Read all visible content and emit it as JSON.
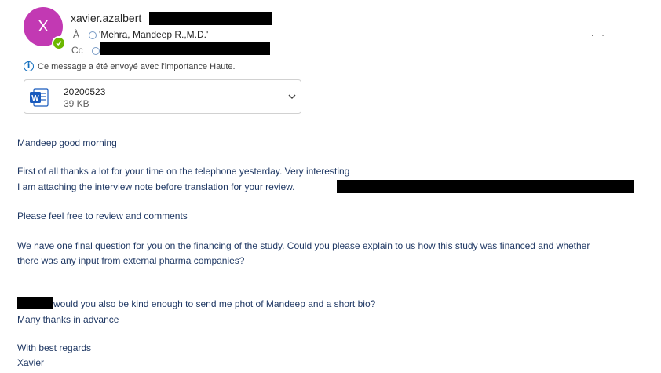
{
  "header": {
    "avatar_initial": "X",
    "sender_name": "xavier.azalbert",
    "to_label": "À",
    "to_value": "'Mehra, Mandeep R.,M.D.'",
    "cc_label": "Cc"
  },
  "importance_notice": "Ce message a été envoyé avec l'importance Haute.",
  "attachment": {
    "name": "20200523",
    "size": "39 KB",
    "icon": "word-document-icon"
  },
  "body": {
    "greeting": "Mandeep good morning",
    "p1_line1": "First of all thanks a lot for your time on the telephone yesterday. Very interesting",
    "p1_line2": "I am attaching the interview note before translation for your review.",
    "p2": "Please feel free to review and comments",
    "p3_line1": "We have one final question for you on the financing of the study.  Could you please explain to us how this study was financed and whether",
    "p3_line2": "there was any input from external pharma companies?",
    "p4_line1": "would you also be kind enough to send me  phot of Mandeep and a short bio?",
    "p4_line2": "Many thanks in advance",
    "closing": "With best regards",
    "signature": "Xavier"
  },
  "colors": {
    "avatar": "#c239b3",
    "presence": "#6bb700",
    "body_text": "#1f3864",
    "info_accent": "#0f6cbd",
    "word_blue": "#185abd"
  }
}
